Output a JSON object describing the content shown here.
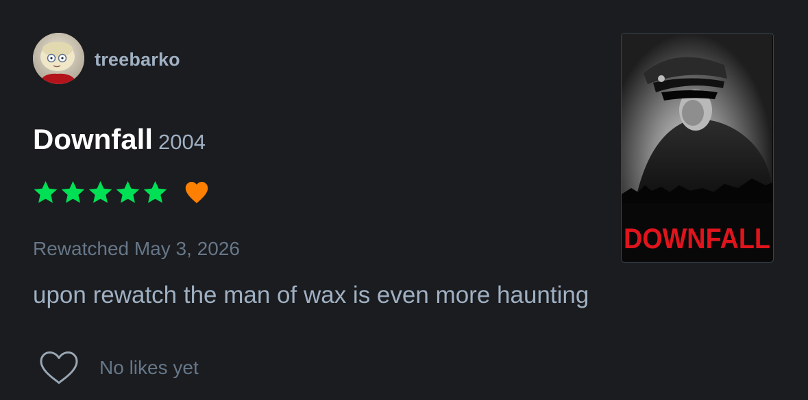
{
  "review": {
    "author": "treebarko",
    "film_title": "Downfall",
    "film_year": "2004",
    "rating_stars": 5,
    "liked": true,
    "watch_label": "Rewatched May 3, 2026",
    "text": "upon rewatch the man of wax is even more haunting"
  },
  "likes": {
    "label": "No likes yet",
    "count": 0
  },
  "poster": {
    "title_text": "DOWNFALL"
  },
  "colors": {
    "background": "#1b1c20",
    "star": "#00e054",
    "heart": "#ff8000",
    "username": "#9fb0c2",
    "muted": "#667788",
    "poster_title": "#e0141c"
  },
  "icons": {
    "avatar": "avatar-image",
    "star": "star-icon",
    "liked": "heart-icon",
    "like_button": "heart-outline-icon"
  }
}
